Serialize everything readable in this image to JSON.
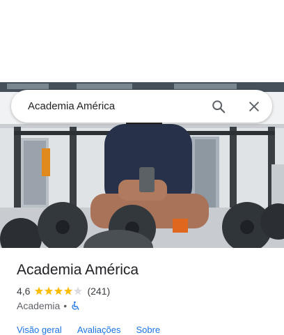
{
  "search": {
    "query": "Academia América",
    "icons": {
      "search": "search-icon",
      "close": "close-icon"
    }
  },
  "photo": {
    "subject": "gym-mirror-selfie"
  },
  "place": {
    "name": "Academia América",
    "rating": "4,6",
    "rating_value": 4.6,
    "rating_max": 5,
    "review_count": "(241)",
    "category": "Academia",
    "separator": "•",
    "accessibility_icon": "wheelchair-icon"
  },
  "tabs": [
    {
      "label": "Visão geral"
    },
    {
      "label": "Avaliações"
    },
    {
      "label": "Sobre"
    }
  ],
  "colors": {
    "star": "#fbbc04",
    "accent": "#1a73e8",
    "title": "#202124"
  }
}
